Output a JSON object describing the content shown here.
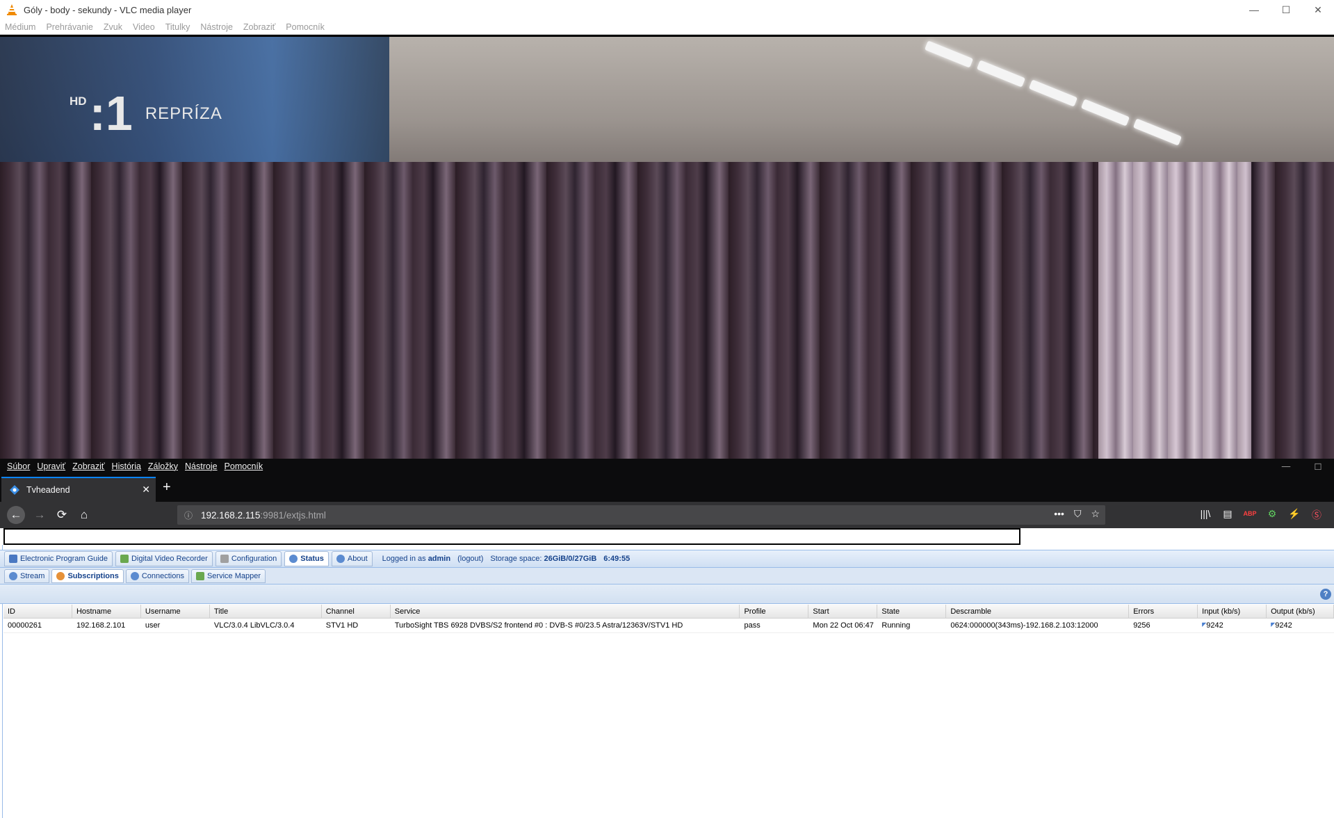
{
  "vlc": {
    "title": "Góly - body - sekundy - VLC media player",
    "menu": [
      "Médium",
      "Prehrávanie",
      "Zvuk",
      "Video",
      "Titulky",
      "Nástroje",
      "Zobraziť",
      "Pomocník"
    ],
    "window_controls": {
      "minimize": "—",
      "maximize": "☐",
      "close": "✕"
    }
  },
  "video": {
    "logo_hd": "HD",
    "logo_num": ":1",
    "logo_text": "REPRÍZA"
  },
  "firefox": {
    "menu": [
      "Súbor",
      "Upraviť",
      "Zobraziť",
      "História",
      "Záložky",
      "Nástroje",
      "Pomocník"
    ],
    "window_controls": {
      "minimize": "—",
      "maximize": "☐"
    },
    "tab": {
      "label": "Tvheadend",
      "close": "✕"
    },
    "new_tab": "+",
    "url_host": "192.168.2.115",
    "url_path": ":9981/extjs.html",
    "nav": {
      "back": "←",
      "forward": "→",
      "reload": "⟳",
      "home": "⌂"
    },
    "url_right": {
      "more": "•••",
      "pocket": "⛉",
      "star": "☆"
    },
    "toolbar_icons": [
      "library-icon",
      "sidebar-icon",
      "adblock-icon",
      "extension-icon",
      "bolt-icon",
      "s-icon"
    ],
    "toolbar_glyphs": [
      "|||\\",
      "▤",
      "ABP",
      "⚙",
      "⚡",
      "Ⓢ"
    ]
  },
  "tvheadend": {
    "tabs": [
      {
        "label": "Electronic Program Guide",
        "icon_color": "#4a78c2"
      },
      {
        "label": "Digital Video Recorder",
        "icon_color": "#6aa84f"
      },
      {
        "label": "Configuration",
        "icon_color": "#a0a0a0"
      },
      {
        "label": "Status",
        "icon_color": "#5b8bd0"
      },
      {
        "label": "About",
        "icon_color": "#5b8bd0"
      }
    ],
    "logged_in_prefix": "Logged in as",
    "user": "admin",
    "logout": "(logout)",
    "storage_label": "Storage space:",
    "storage_value": "26GiB/0/27GiB",
    "clock": "6:49:55",
    "sub_tabs": [
      {
        "label": "Stream",
        "icon_color": "#5b8bd0"
      },
      {
        "label": "Subscriptions",
        "icon_color": "#e69138"
      },
      {
        "label": "Connections",
        "icon_color": "#5b8bd0"
      },
      {
        "label": "Service Mapper",
        "icon_color": "#6aa84f"
      }
    ],
    "help": "?",
    "columns": [
      "ID",
      "Hostname",
      "Username",
      "Title",
      "Channel",
      "Service",
      "Profile",
      "Start",
      "State",
      "Descramble",
      "Errors",
      "Input (kb/s)",
      "Output (kb/s)"
    ],
    "rows": [
      {
        "id": "00000261",
        "hostname": "192.168.2.101",
        "username": "user",
        "title": "VLC/3.0.4 LibVLC/3.0.4",
        "channel": "STV1 HD",
        "service": "TurboSight TBS 6928 DVBS/S2 frontend #0 : DVB-S #0/23.5 Astra/12363V/STV1 HD",
        "profile": "pass",
        "start": "Mon 22 Oct 06:47",
        "state": "Running",
        "descramble": "0624:000000(343ms)-192.168.2.103:12000",
        "errors": "9256",
        "input": "9242",
        "output": "9242"
      }
    ]
  }
}
